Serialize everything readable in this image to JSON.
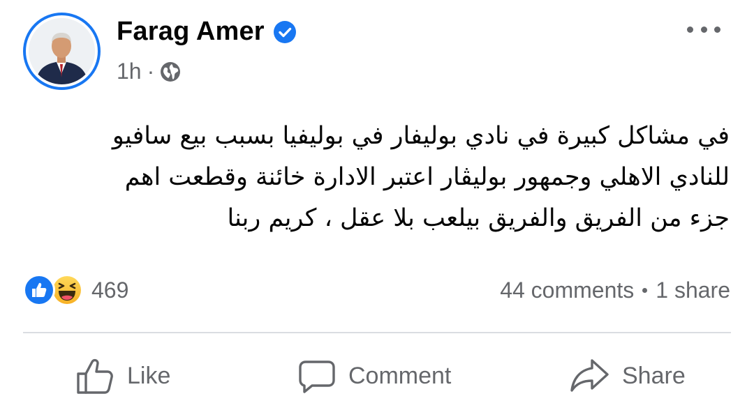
{
  "post": {
    "author": "Farag Amer",
    "time": "1h",
    "separator": "·",
    "body": "في مشاكل كبيرة في نادي بوليفار في بوليفيا بسبب بيع سافيو\nللنادي الاهلي  وجمهور بوليڤار اعتبر الادارة خائنة وقطعت اهم\nجزء من الفريق والفريق بيلعب بلا عقل ، كريم ربنا"
  },
  "stats": {
    "reaction_count": "469",
    "comments": "44 comments",
    "shares": "1 share"
  },
  "actions": {
    "like": "Like",
    "comment": "Comment",
    "share": "Share"
  },
  "colors": {
    "accent": "#1877f2",
    "secondary_text": "#65676b",
    "divider": "#dadde1"
  },
  "icons": {
    "verified": "verified-badge-icon",
    "audience": "globe-icon",
    "more": "more-horizontal-icon",
    "reaction_like": "like-reaction-icon",
    "reaction_haha": "haha-reaction-icon"
  }
}
